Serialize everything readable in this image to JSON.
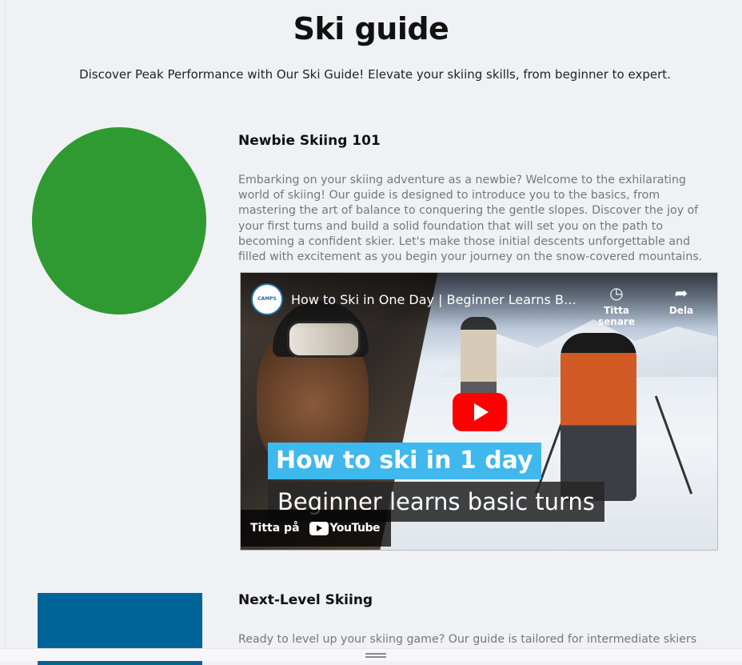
{
  "page": {
    "title": "Ski guide",
    "intro": "Discover Peak Performance with Our Ski Guide! Elevate your skiing skills, from beginner to expert."
  },
  "sections": [
    {
      "title": "Newbie Skiing 101",
      "text": "Embarking on your skiing adventure as a newbie? Welcome to the exhilarating world of skiing! Our guide is designed to introduce you to the basics, from mastering the art of balance to conquering the gentle slopes. Discover the joy of your first turns and build a solid foundation that will set you on the path to becoming a confident skier. Let's make those initial descents unforgettable and filled with excitement as you begin your journey on the snow-covered mountains.",
      "shape_color": "#2f9a32",
      "video": {
        "title": "How to Ski in One Day | Beginner Learns Ba...",
        "watch_later": "Titta senare",
        "share": "Dela",
        "caption_line1": "How to ski in 1 day",
        "caption_line2": "Beginner learns basic turns",
        "watch_on": "Titta på",
        "youtube_word": "YouTube",
        "channel_logo_text": "CAMPS"
      }
    },
    {
      "title": "Next-Level Skiing",
      "text": "Ready to level up your skiing game? Our guide is tailored for intermediate skiers",
      "shape_color": "#006398"
    }
  ],
  "icons": {
    "watch_later": "clock-icon",
    "share": "share-arrow-icon",
    "play": "play-icon",
    "youtube": "youtube-logo-icon",
    "grip": "resize-grip-icon"
  }
}
